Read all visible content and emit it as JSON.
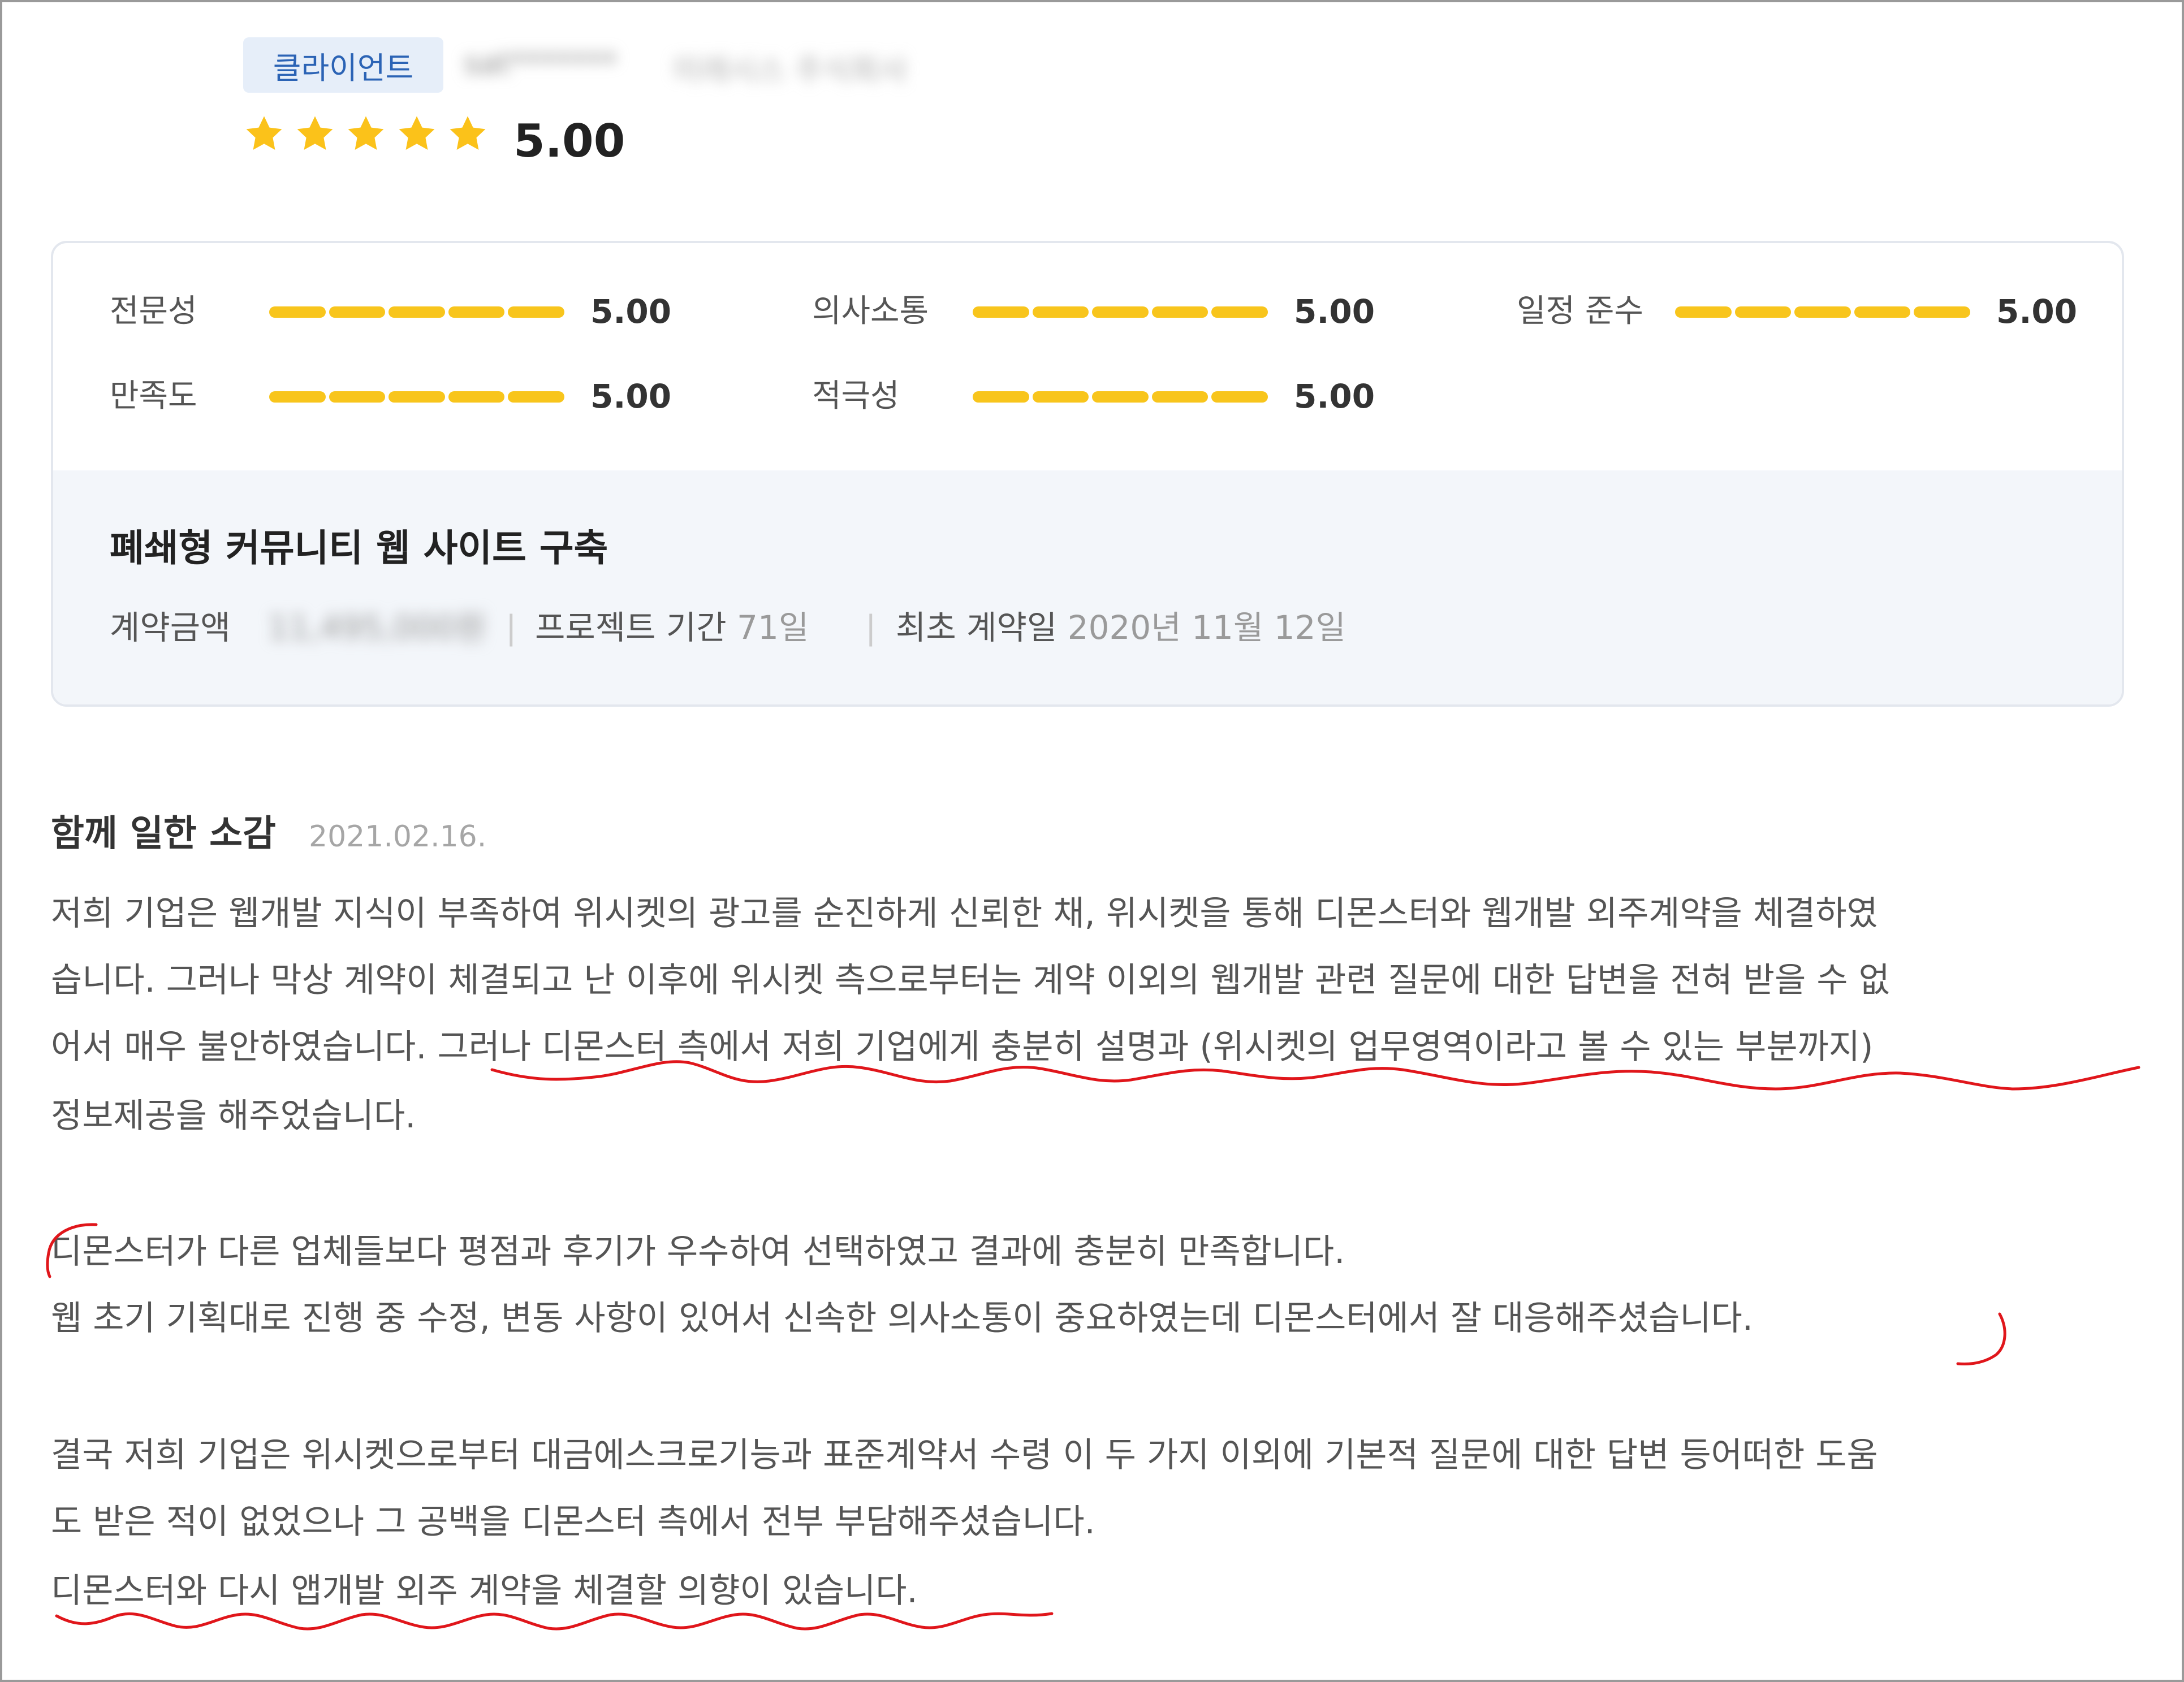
{
  "header": {
    "role_badge": "클라이언트",
    "client_name_blurred": "sat*******",
    "client_company_blurred": "미래시스 주식회사",
    "stars_filled": 5,
    "stars_total": 5,
    "rating": "5.00",
    "star_color": "#fbc21a"
  },
  "scores": [
    {
      "label": "전문성",
      "value": "5.00"
    },
    {
      "label": "의사소통",
      "value": "5.00"
    },
    {
      "label": "일정 준수",
      "value": "5.00"
    },
    {
      "label": "만족도",
      "value": "5.00"
    },
    {
      "label": "적극성",
      "value": "5.00"
    }
  ],
  "bar_color": "#f8c51c",
  "project": {
    "title": "폐쇄형 커뮤니티 웹 사이트 구축",
    "contract_amount_label": "계약금액",
    "contract_amount_blurred": "11,495,000원",
    "period_label": "프로젝트 기간",
    "period_value": "71일",
    "first_contract_label": "최초 계약일",
    "first_contract_value": "2020년 11월 12일",
    "separator": "|"
  },
  "review": {
    "heading": "함께 일한 소감",
    "date": "2021.02.16.",
    "lines": [
      "저희 기업은 웹개발 지식이 부족하여 위시켓의 광고를 순진하게 신뢰한 채, 위시켓을 통해 디몬스터와 웹개발 외주계약을 체결하였",
      "습니다. 그러나 막상 계약이 체결되고 난 이후에 위시켓 측으로부터는 계약 이외의 웹개발 관련 질문에 대한 답변을 전혀 받을 수 없",
      "어서 매우 불안하였습니다. 그러나 디몬스터 측에서 저희 기업에게 충분히 설명과 (위시켓의 업무영역이라고 볼 수 있는 부분까지)",
      "정보제공을 해주었습니다.",
      "디몬스터가 다른 업체들보다 평점과 후기가 우수하여 선택하였고 결과에 충분히 만족합니다.",
      "웹 초기 기획대로 진행 중 수정, 변동 사항이 있어서 신속한 의사소통이 중요하였는데 디몬스터에서 잘 대응해주셨습니다.",
      "결국 저희 기업은 위시켓으로부터 대금에스크로기능과 표준계약서 수령 이 두 가지 이외에 기본적 질문에 대한 답변 등어떠한 도움",
      "도 받은 적이 없었으나 그 공백을 디몬스터 측에서 전부 부담해주셨습니다.",
      "디몬스터와 다시 앱개발 외주 계약을 체결할 의향이 있습니다."
    ]
  },
  "annotation_color": "#e0161b"
}
